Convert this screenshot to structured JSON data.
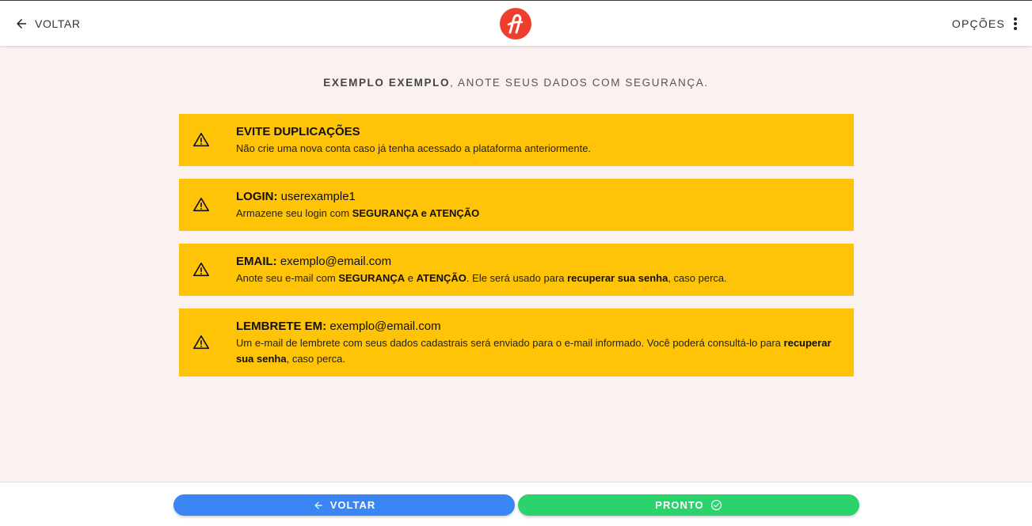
{
  "topbar": {
    "back_label": "VOLTAR",
    "options_label": "OPÇÕES",
    "back_icon": "arrow-left-icon",
    "options_icon": "more-vertical-icon",
    "logo_icon": "brand-logo-icon"
  },
  "main": {
    "heading_bold": "EXEMPLO EXEMPLO",
    "heading_rest": ", ANOTE SEUS DADOS COM SEGURANÇA."
  },
  "cards": [
    {
      "title_bold": "EVITE DUPLICAÇÕES",
      "title_value": "",
      "desc_1": "Não crie uma nova conta caso já tenha acessado a plataforma anteriormente."
    },
    {
      "title_bold": "LOGIN:",
      "title_value": " userexample1",
      "desc_1": "Armazene seu login com ",
      "desc_1b": "SEGURANÇA e ATENÇÃO"
    },
    {
      "title_bold": "EMAIL:",
      "title_value": " exemplo@email.com",
      "desc_1": "Anote seu e-mail com ",
      "desc_1b": "SEGURANÇA",
      "desc_2": " e ",
      "desc_2b": "ATENÇÃO",
      "desc_3": ". Ele será usado para ",
      "desc_3b": "recuperar sua senha",
      "desc_4": ", caso perca."
    },
    {
      "title_bold": "LEMBRETE EM:",
      "title_value": " exemplo@email.com",
      "desc_1": "Um e-mail de lembrete com seus dados cadastrais será enviado para o e-mail informado. Você poderá consultá-lo para ",
      "desc_1b": "recuperar sua senha",
      "desc_2": ", caso perca."
    }
  ],
  "footer": {
    "back_button": "VOLTAR",
    "done_button": "PRONTO",
    "back_icon": "arrow-left-icon",
    "done_icon": "check-circle-icon"
  },
  "colors": {
    "card_bg": "#ffc408",
    "back_button": "#3a86f5",
    "done_button": "#2ad36b",
    "logo": "#ee3e2c",
    "page_bg": "#fcf1f1"
  }
}
